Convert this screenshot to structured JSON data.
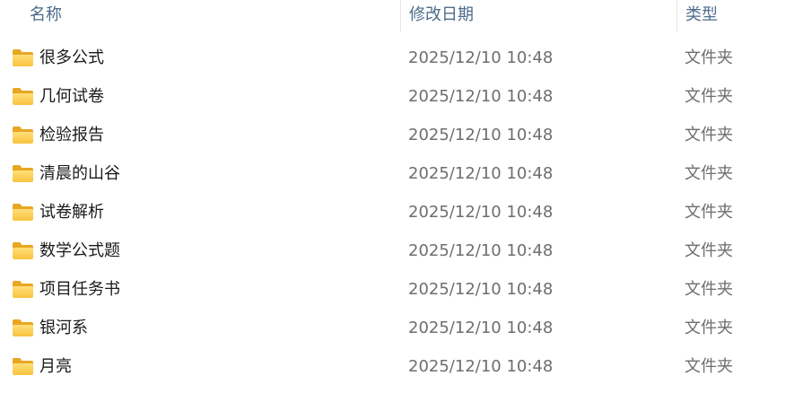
{
  "columns": {
    "name": "名称",
    "date": "修改日期",
    "type": "类型"
  },
  "accent_color": "#f9c33e",
  "rows": [
    {
      "name": "很多公式",
      "date": "2025/12/10 10:48",
      "type": "文件夹",
      "icon": "folder-icon"
    },
    {
      "name": "几何试卷",
      "date": "2025/12/10 10:48",
      "type": "文件夹",
      "icon": "folder-icon"
    },
    {
      "name": "检验报告",
      "date": "2025/12/10 10:48",
      "type": "文件夹",
      "icon": "folder-icon"
    },
    {
      "name": "清晨的山谷",
      "date": "2025/12/10 10:48",
      "type": "文件夹",
      "icon": "folder-icon"
    },
    {
      "name": "试卷解析",
      "date": "2025/12/10 10:48",
      "type": "文件夹",
      "icon": "folder-icon"
    },
    {
      "name": "数学公式题",
      "date": "2025/12/10 10:48",
      "type": "文件夹",
      "icon": "folder-icon"
    },
    {
      "name": "项目任务书",
      "date": "2025/12/10 10:48",
      "type": "文件夹",
      "icon": "folder-icon"
    },
    {
      "name": "银河系",
      "date": "2025/12/10 10:48",
      "type": "文件夹",
      "icon": "folder-icon"
    },
    {
      "name": "月亮",
      "date": "2025/12/10 10:48",
      "type": "文件夹",
      "icon": "folder-icon"
    }
  ]
}
